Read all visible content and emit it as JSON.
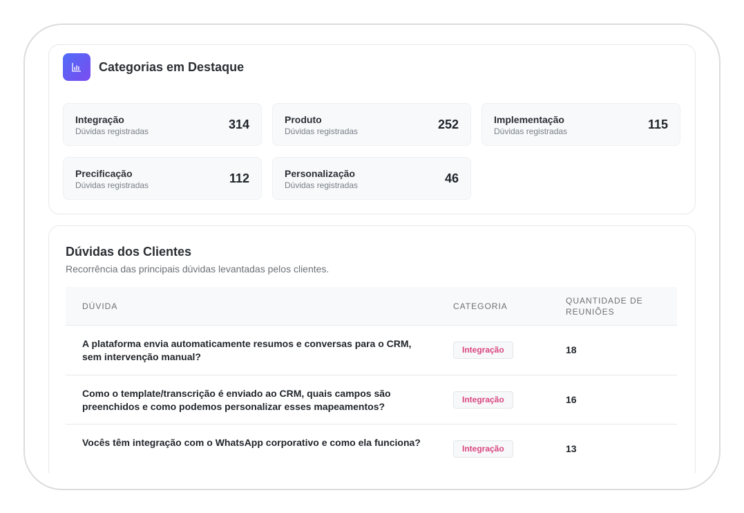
{
  "categories_section": {
    "title": "Categorias em Destaque",
    "icon": "bar-chart-icon",
    "items": [
      {
        "name": "Integração",
        "subtitle": "Dúvidas registradas",
        "count": "314"
      },
      {
        "name": "Produto",
        "subtitle": "Dúvidas registradas",
        "count": "252"
      },
      {
        "name": "Implementação",
        "subtitle": "Dúvidas registradas",
        "count": "115"
      },
      {
        "name": "Precificação",
        "subtitle": "Dúvidas registradas",
        "count": "112"
      },
      {
        "name": "Personalização",
        "subtitle": "Dúvidas registradas",
        "count": "46"
      }
    ]
  },
  "questions_section": {
    "title": "Dúvidas dos Clientes",
    "subtitle": "Recorrência das principais dúvidas levantadas pelos clientes.",
    "columns": {
      "question": "Dúvida",
      "category": "Categoria",
      "count": "Quantidade de Reuniões"
    },
    "rows": [
      {
        "question": "A plataforma envia automaticamente resumos e conversas para o CRM, sem intervenção manual?",
        "category": "Integração",
        "count": "18"
      },
      {
        "question": "Como o template/transcrição é enviado ao CRM, quais campos são preenchidos e como podemos personalizar esses mapeamentos?",
        "category": "Integração",
        "count": "16"
      },
      {
        "question": "Vocês têm integração com o WhatsApp corporativo e como ela funciona?",
        "category": "Integração",
        "count": "13"
      }
    ]
  },
  "colors": {
    "accent_gradient_start": "#4f6cf7",
    "accent_gradient_end": "#7b4cf0",
    "tag_text": "#d9467f"
  }
}
